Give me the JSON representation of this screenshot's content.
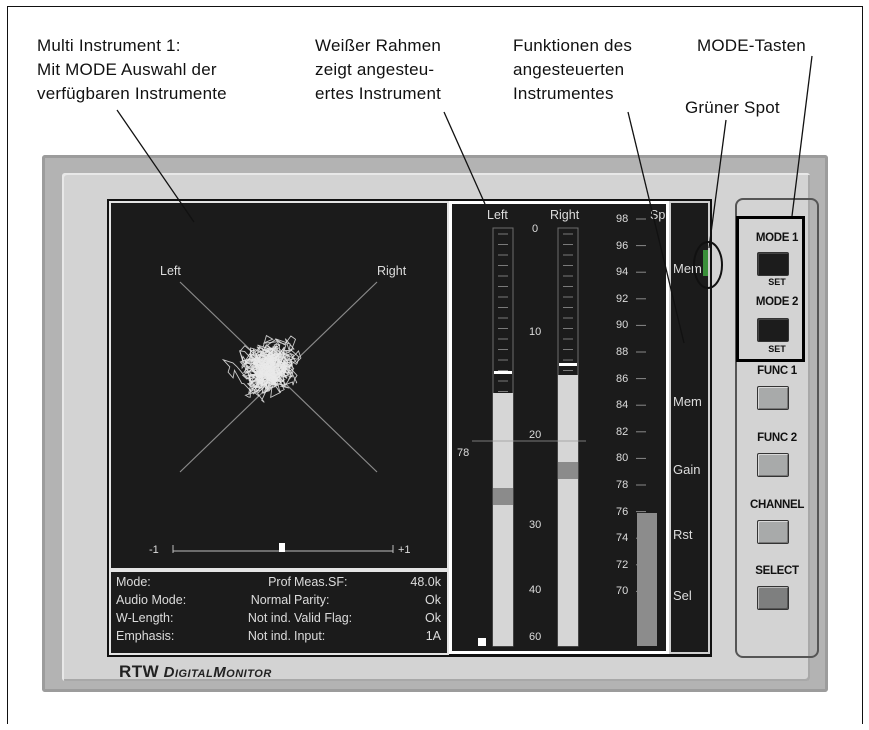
{
  "annotations": {
    "multi_instrument": [
      "Multi Instrument 1:",
      "Mit MODE Auswahl der",
      "verfügbaren Instrumente"
    ],
    "weisser_rahmen": [
      "Weißer Rahmen",
      "zeigt angesteu-",
      "ertes Instrument"
    ],
    "funktionen": [
      "Funktionen des",
      "angesteuerten",
      "Instrumentes"
    ],
    "mode_tasten": "MODE-Tasten",
    "gruener_spot": "Grüner Spot"
  },
  "vectorscope": {
    "left_label": "Left",
    "right_label": "Right",
    "scale_min": "-1",
    "scale_max": "+1"
  },
  "status": {
    "rows": [
      {
        "k1": "Mode:",
        "v1": "Prof",
        "k2": "Meas.SF:",
        "v2": "48.0k"
      },
      {
        "k1": "Audio Mode:",
        "v1": "Normal",
        "k2": "Parity:",
        "v2": "Ok"
      },
      {
        "k1": "W-Length:",
        "v1": "Not ind.",
        "k2": "Valid Flag:",
        "v2": "Ok"
      },
      {
        "k1": "Emphasis:",
        "v1": "Not ind.",
        "k2": "Input:",
        "v2": "1A"
      }
    ]
  },
  "meter": {
    "header_left": "Left",
    "header_right": "Right",
    "header_sp": "Sp",
    "center_scale": [
      "0",
      "10",
      "20",
      "30",
      "40",
      "60"
    ],
    "marker_78": "78",
    "sp_scale": [
      "98",
      "96",
      "94",
      "92",
      "90",
      "88",
      "86",
      "84",
      "82",
      "80",
      "78",
      "76",
      "74",
      "72",
      "70"
    ]
  },
  "functions": [
    "Mem",
    "",
    "Mem",
    "Gain",
    "Rst",
    "Sel"
  ],
  "brand": {
    "rtw": "RTW",
    "digital": "Digital",
    "monitor": "Monitor"
  },
  "buttons": [
    {
      "label": "MODE 1",
      "sub": "SET",
      "style": "dark"
    },
    {
      "label": "MODE 2",
      "sub": "SET",
      "style": "dark"
    },
    {
      "label": "FUNC 1",
      "sub": "",
      "style": "grey"
    },
    {
      "label": "FUNC 2",
      "sub": "",
      "style": "grey"
    },
    {
      "label": "CHANNEL",
      "sub": "",
      "style": "grey"
    },
    {
      "label": "SELECT",
      "sub": "",
      "style": "mid"
    }
  ],
  "colors": {
    "green_spot": "#3a8f3a",
    "meter_fill": "#d6d6d6",
    "meter_mark": "#8b8b8b"
  }
}
